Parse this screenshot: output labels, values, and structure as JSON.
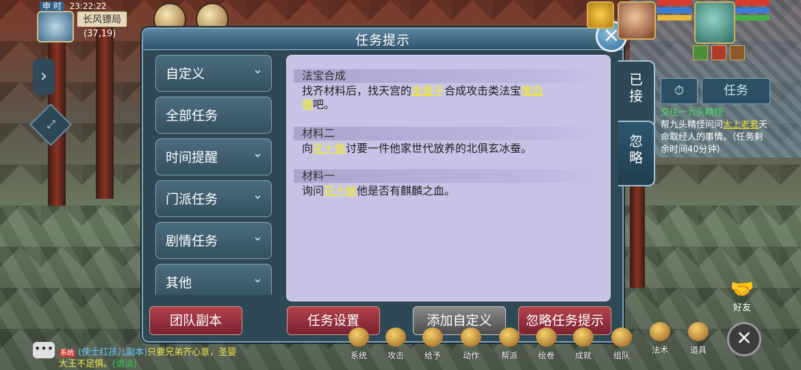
{
  "hud": {
    "time_label": "申 时",
    "time": "23:22:22",
    "location": "长风镖局",
    "coords": "(37,19)"
  },
  "dialog": {
    "title": "任务提示",
    "close_icon": "close-icon",
    "categories": [
      {
        "label": "自定义"
      },
      {
        "label": "全部任务"
      },
      {
        "label": "时间提醒"
      },
      {
        "label": "门派任务"
      },
      {
        "label": "剧情任务"
      },
      {
        "label": "其他"
      }
    ],
    "side_tabs": [
      {
        "label_1": "已",
        "label_2": "接"
      },
      {
        "label_1": "忽",
        "label_2": "略"
      }
    ],
    "sections": [
      {
        "title": "法宝合成",
        "text_1": "找齐材料后，找天宫的",
        "link_1": "金童子",
        "text_2": "合成攻击类法宝",
        "link_2": "嗜血",
        "link_3": "幡",
        "text_3": "吧。"
      },
      {
        "title": "材料二",
        "text_1": "向",
        "link_1": "花十娘",
        "text_2": "讨要一件他家世代放养的北俱玄冰蚕。"
      },
      {
        "title": "材料一",
        "text_1": "询问",
        "link_1": "花十娘",
        "text_2": "他是否有麒麟之血。"
      }
    ],
    "buttons": {
      "team_dungeon": "团队副本",
      "task_settings": "任务设置",
      "add_custom": "添加自定义",
      "ignore_hints": "忽略任务提示"
    }
  },
  "task_panel": {
    "tab_label": "任务",
    "title": "交往一九头精怪",
    "line_1": "帮九头精怪问问",
    "link": "太上老君",
    "line_2": "天命取经人的事情。（任务剩余时间40分钟）"
  },
  "friend_label": "好友",
  "bottom_menu": [
    {
      "label": "系统"
    },
    {
      "label": "攻击"
    },
    {
      "label": "给予"
    },
    {
      "label": "动作"
    },
    {
      "label": "帮派"
    },
    {
      "label": "绘卷"
    },
    {
      "label": "成就"
    },
    {
      "label": "组队"
    },
    {
      "label": "法术"
    },
    {
      "label": "道具"
    }
  ],
  "chat": {
    "tag": "系统",
    "sender": "(侠士红孩儿副本)",
    "message": "只要兄弟齐心意，圣婴大王不足惧。",
    "action": "(谙淡)"
  },
  "colors": {
    "link_yellow": "#f2ea20",
    "panel_lavender": "#c8c3e6",
    "button_red": "#b2404d"
  }
}
